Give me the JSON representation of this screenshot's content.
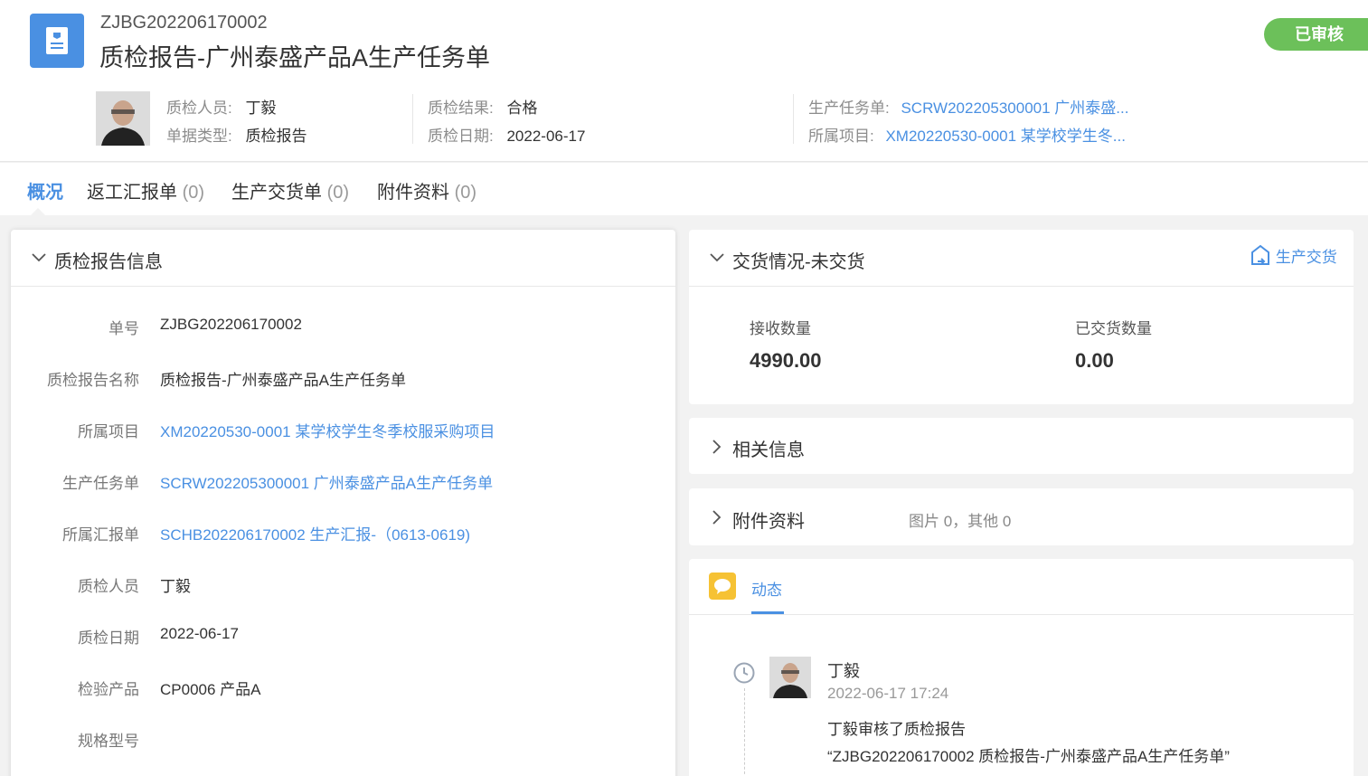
{
  "header": {
    "code": "ZJBG202206170002",
    "title": "质检报告-广州泰盛产品A生产任务单",
    "status": "已审核",
    "inspector_label": "质检人员:",
    "inspector": "丁毅",
    "doc_type_label": "单据类型:",
    "doc_type": "质检报告",
    "result_label": "质检结果:",
    "result": "合格",
    "date_label": "质检日期:",
    "date": "2022-06-17",
    "task_label": "生产任务单:",
    "task": "SCRW202205300001 广州泰盛...",
    "project_label": "所属项目:",
    "project": "XM20220530-0001 某学校学生冬..."
  },
  "tabs": [
    {
      "label": "概况",
      "count": ""
    },
    {
      "label": "返工汇报单",
      "count": "(0)"
    },
    {
      "label": "生产交货单",
      "count": "(0)"
    },
    {
      "label": "附件资料",
      "count": "(0)"
    }
  ],
  "info": {
    "title": "质检报告信息",
    "fields": [
      {
        "label": "单号",
        "value": "ZJBG202206170002"
      },
      {
        "label": "质检报告名称",
        "value": "质检报告-广州泰盛产品A生产任务单"
      },
      {
        "label": "所属项目",
        "value": "XM20220530-0001 某学校学生冬季校服采购项目"
      },
      {
        "label": "生产任务单",
        "value": "SCRW202205300001 广州泰盛产品A生产任务单"
      },
      {
        "label": "所属汇报单",
        "value": "SCHB202206170002 生产汇报-（0613-0619)"
      },
      {
        "label": "质检人员",
        "value": "丁毅"
      },
      {
        "label": "质检日期",
        "value": "2022-06-17"
      },
      {
        "label": "检验产品",
        "value": "CP0006 产品A"
      },
      {
        "label": "规格型号",
        "value": ""
      }
    ]
  },
  "delivery": {
    "title": "交货情况-未交货",
    "action": "生产交货",
    "received_label": "接收数量",
    "received": "4990.00",
    "delivered_label": "已交货数量",
    "delivered": "0.00"
  },
  "related": {
    "title": "相关信息"
  },
  "attachments": {
    "title": "附件资料",
    "summary": "图片 0，其他 0"
  },
  "feed": {
    "tab": "动态",
    "user": "丁毅",
    "time": "2022-06-17 17:24",
    "action": "丁毅审核了质检报告",
    "doc": "“ZJBG202206170002 质检报告-广州泰盛产品A生产任务单”"
  },
  "colors": {
    "accent": "#4a90e2",
    "approved": "#6cc05a",
    "feed_icon": "#f6c234"
  },
  "icons": [
    "document-icon",
    "chevron-down-icon",
    "chevron-right-icon",
    "delivery-icon",
    "chat-bubble-icon",
    "clock-icon"
  ]
}
